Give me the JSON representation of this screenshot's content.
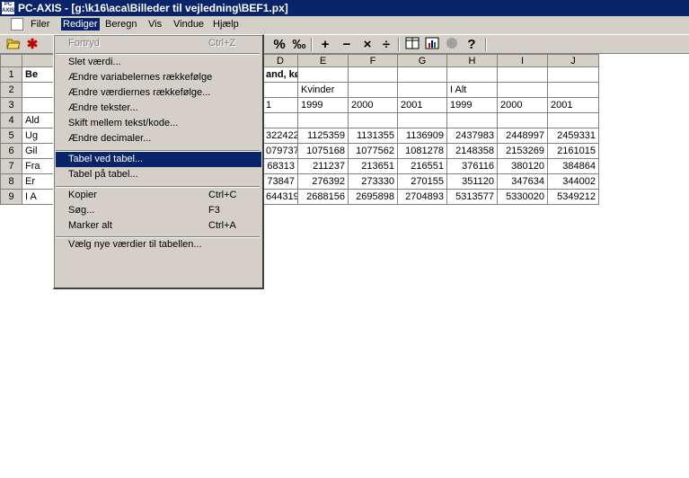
{
  "window": {
    "title": "PC-AXIS - [g:\\k16\\aca\\Billeder til vejledning\\BEF1.px]",
    "app_icon": "PC AXIS"
  },
  "menubar": [
    {
      "label": "Filer"
    },
    {
      "label": "Rediger"
    },
    {
      "label": "Beregn"
    },
    {
      "label": "Vis"
    },
    {
      "label": "Vindue"
    },
    {
      "label": "Hjælp"
    }
  ],
  "toolbar": {
    "open_icon": "folder-open-icon",
    "star_icon": "asterisk-icon",
    "percent": "%",
    "permille": "‰",
    "plus": "+",
    "minus": "−",
    "times": "×",
    "divide": "÷",
    "table_icon": "table-icon",
    "chart_icon": "bar-chart-icon",
    "pie_icon": "pie-icon",
    "help_icon": "?"
  },
  "edit_menu": {
    "items": [
      {
        "label": "Fortryd",
        "shortcut": "Ctrl+Z",
        "disabled": true
      },
      {
        "label": "Slet værdi..."
      },
      {
        "label": "Ændre variabelernes rækkefølge"
      },
      {
        "label": "Ændre værdiernes rækkefølge..."
      },
      {
        "label": "Ændre tekster..."
      },
      {
        "label": "Skift mellem tekst/kode..."
      },
      {
        "label": "Ændre decimaler..."
      },
      {
        "label": "Tabel ved tabel...",
        "highlighted": true
      },
      {
        "label": "Tabel på tabel..."
      },
      {
        "label": "Kopier",
        "shortcut": "Ctrl+C"
      },
      {
        "label": "Søg...",
        "shortcut": "F3"
      },
      {
        "label": "Marker alt",
        "shortcut": "Ctrl+A"
      },
      {
        "label": "Vælg nye værdier til tabellen..."
      }
    ]
  },
  "grid": {
    "columns": [
      "D",
      "E",
      "F",
      "G",
      "H",
      "I",
      "J"
    ],
    "rows": [
      {
        "num": "1",
        "a": "Be",
        "cells": [
          "and, køn og tid.",
          "",
          "",
          "",
          "",
          "",
          ""
        ]
      },
      {
        "num": "2",
        "a": "",
        "cells": [
          "",
          "Kvinder",
          "",
          "",
          "I Alt",
          "",
          ""
        ]
      },
      {
        "num": "3",
        "a": "",
        "cells": [
          "1",
          "1999",
          "2000",
          "2001",
          "1999",
          "2000",
          "2001"
        ]
      },
      {
        "num": "4",
        "a": "Ald",
        "cells": [
          "",
          "",
          "",
          "",
          "",
          "",
          ""
        ]
      },
      {
        "num": "5",
        "a": "Ug",
        "cells": [
          "322422",
          "1125359",
          "1131355",
          "1136909",
          "2437983",
          "2448997",
          "2459331"
        ]
      },
      {
        "num": "6",
        "a": "Gil",
        "cells": [
          "079737",
          "1075168",
          "1077562",
          "1081278",
          "2148358",
          "2153269",
          "2161015"
        ]
      },
      {
        "num": "7",
        "a": "Fra",
        "cells": [
          "68313",
          "211237",
          "213651",
          "216551",
          "376116",
          "380120",
          "384864"
        ]
      },
      {
        "num": "8",
        "a": "Er",
        "cells": [
          "73847",
          "276392",
          "273330",
          "270155",
          "351120",
          "347634",
          "344002"
        ]
      },
      {
        "num": "9",
        "a": "I A",
        "cells": [
          "644319",
          "2688156",
          "2695898",
          "2704893",
          "5313577",
          "5330020",
          "5349212"
        ]
      }
    ]
  }
}
